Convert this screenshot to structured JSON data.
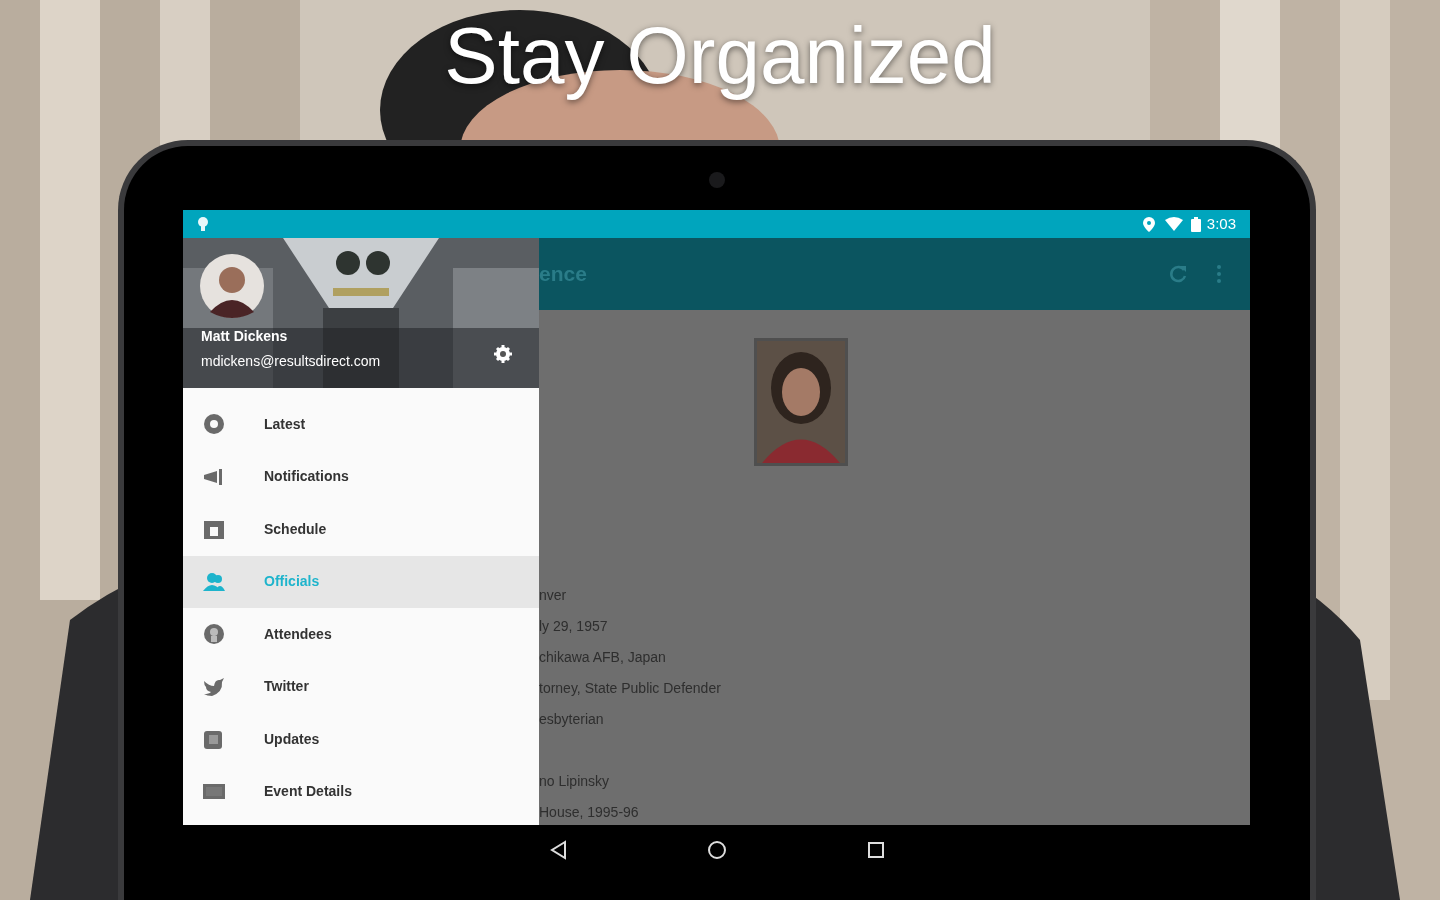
{
  "headline": "Stay Organized",
  "status_bar": {
    "time": "3:03"
  },
  "drawer": {
    "user_name": "Matt Dickens",
    "email": "mdickens@resultsdirect.com",
    "items": [
      {
        "label": "Latest",
        "selected": false
      },
      {
        "label": "Notifications",
        "selected": false
      },
      {
        "label": "Schedule",
        "selected": false
      },
      {
        "label": "Officials",
        "selected": true
      },
      {
        "label": "Attendees",
        "selected": false
      },
      {
        "label": "Twitter",
        "selected": false
      },
      {
        "label": "Updates",
        "selected": false
      },
      {
        "label": "Event Details",
        "selected": false
      }
    ]
  },
  "toolbar": {
    "title": "ence"
  },
  "details": {
    "lines": [
      "nver",
      "ly 29, 1957",
      "chikawa AFB, Japan",
      "torney, State Public Defender",
      "esbyterian"
    ],
    "more_lines": [
      "no Lipinsky",
      "House, 1995-96"
    ]
  }
}
